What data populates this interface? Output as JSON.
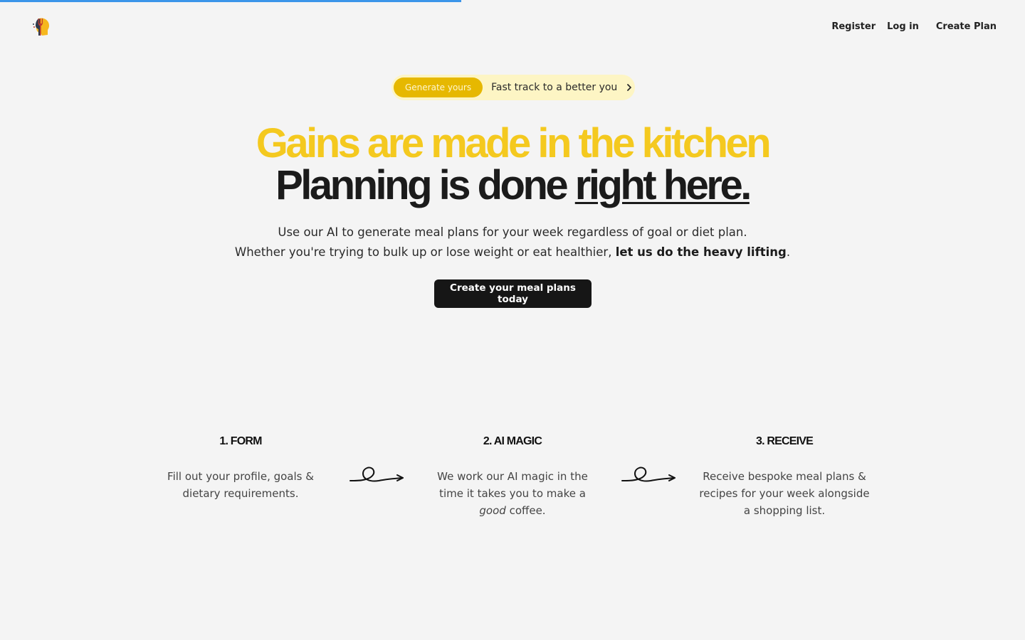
{
  "page": {
    "loading_progress": 0.45,
    "colors": {
      "background": "#f4f4f4",
      "accent_yellow": "#f4c91f",
      "badge_yellow": "#e6b800",
      "pill_background": "#fdf5c4",
      "progress_blue": "#3b95e9",
      "dark": "#161616"
    }
  },
  "header": {
    "logo_icon": "head-with-fork-logo-icon",
    "nav": {
      "register": "Register",
      "login": "Log in",
      "create_plan": "Create Plan"
    }
  },
  "hero": {
    "pill": {
      "badge": "Generate yours",
      "text": "Fast track to a better you",
      "icon": "chevron-right-icon"
    },
    "headline_1": "Gains are made in the kitchen",
    "headline_2_prefix": "Planning is done ",
    "headline_2_underlined": "right here.",
    "subcopy_1": "Use our AI to generate meal plans for your week regardless of goal or diet plan.",
    "subcopy_2_prefix": "Whether you're trying to bulk up or lose weight or eat healthier, ",
    "subcopy_2_bold": "let us do the heavy lifting",
    "subcopy_2_suffix": ".",
    "cta": "Create your meal plans today"
  },
  "steps": [
    {
      "title": "1. FORM",
      "body_prefix": "Fill out your profile, goals & dietary requirements.",
      "body_italic": "",
      "body_suffix": ""
    },
    {
      "title": "2. AI MAGIC",
      "body_prefix": "We work our AI magic in the time it takes you to make a ",
      "body_italic": "good",
      "body_suffix": " coffee."
    },
    {
      "title": "3. RECEIVE",
      "body_prefix": "Receive bespoke meal plans & recipes for your week alongside a shopping list.",
      "body_italic": "",
      "body_suffix": ""
    }
  ],
  "arrows": {
    "icon": "squiggle-arrow-icon"
  }
}
